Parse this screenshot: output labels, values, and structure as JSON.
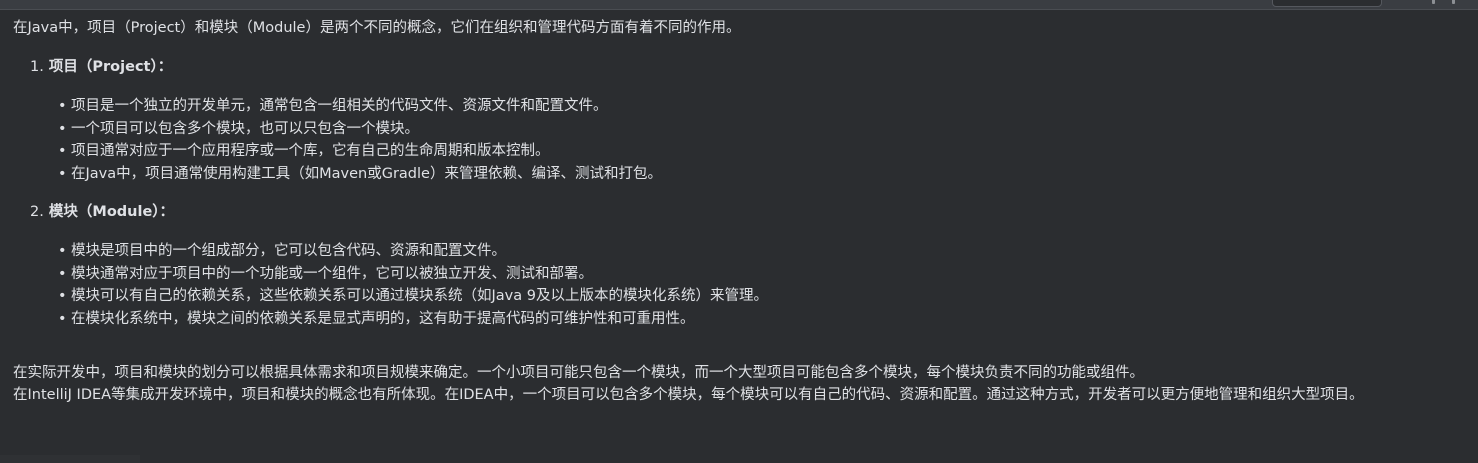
{
  "intro": "在Java中，项目（Project）和模块（Module）是两个不同的概念，它们在组织和管理代码方面有着不同的作用。",
  "sections": [
    {
      "number": "1.",
      "title": "项目（Project）：",
      "items": [
        "项目是一个独立的开发单元，通常包含一组相关的代码文件、资源文件和配置文件。",
        "一个项目可以包含多个模块，也可以只包含一个模块。",
        "项目通常对应于一个应用程序或一个库，它有自己的生命周期和版本控制。",
        "在Java中，项目通常使用构建工具（如Maven或Gradle）来管理依赖、编译、测试和打包。"
      ]
    },
    {
      "number": "2.",
      "title": "模块（Module）：",
      "items": [
        "模块是项目中的一个组成部分，它可以包含代码、资源和配置文件。",
        "模块通常对应于项目中的一个功能或一个组件，它可以被独立开发、测试和部署。",
        "模块可以有自己的依赖关系，这些依赖关系可以通过模块系统（如Java 9及以上版本的模块化系统）来管理。",
        "在模块化系统中，模块之间的依赖关系是显式声明的，这有助于提高代码的可维护性和可重用性。"
      ]
    }
  ],
  "bullet_char": "•",
  "footer": [
    "在实际开发中，项目和模块的划分可以根据具体需求和项目规模来确定。一个小项目可能只包含一个模块，而一个大型项目可能包含多个模块，每个模块负责不同的功能或组件。",
    "在IntelliJ IDEA等集成开发环境中，项目和模块的概念也有所体现。在IDEA中，一个项目可以包含多个模块，每个模块可以有自己的代码、资源和配置。通过这种方式，开发者可以更方便地管理和组织大型项目。"
  ],
  "colors": {
    "background": "#2b2d30",
    "text": "#dfe1e5",
    "top_bar": "#3a3d42"
  }
}
